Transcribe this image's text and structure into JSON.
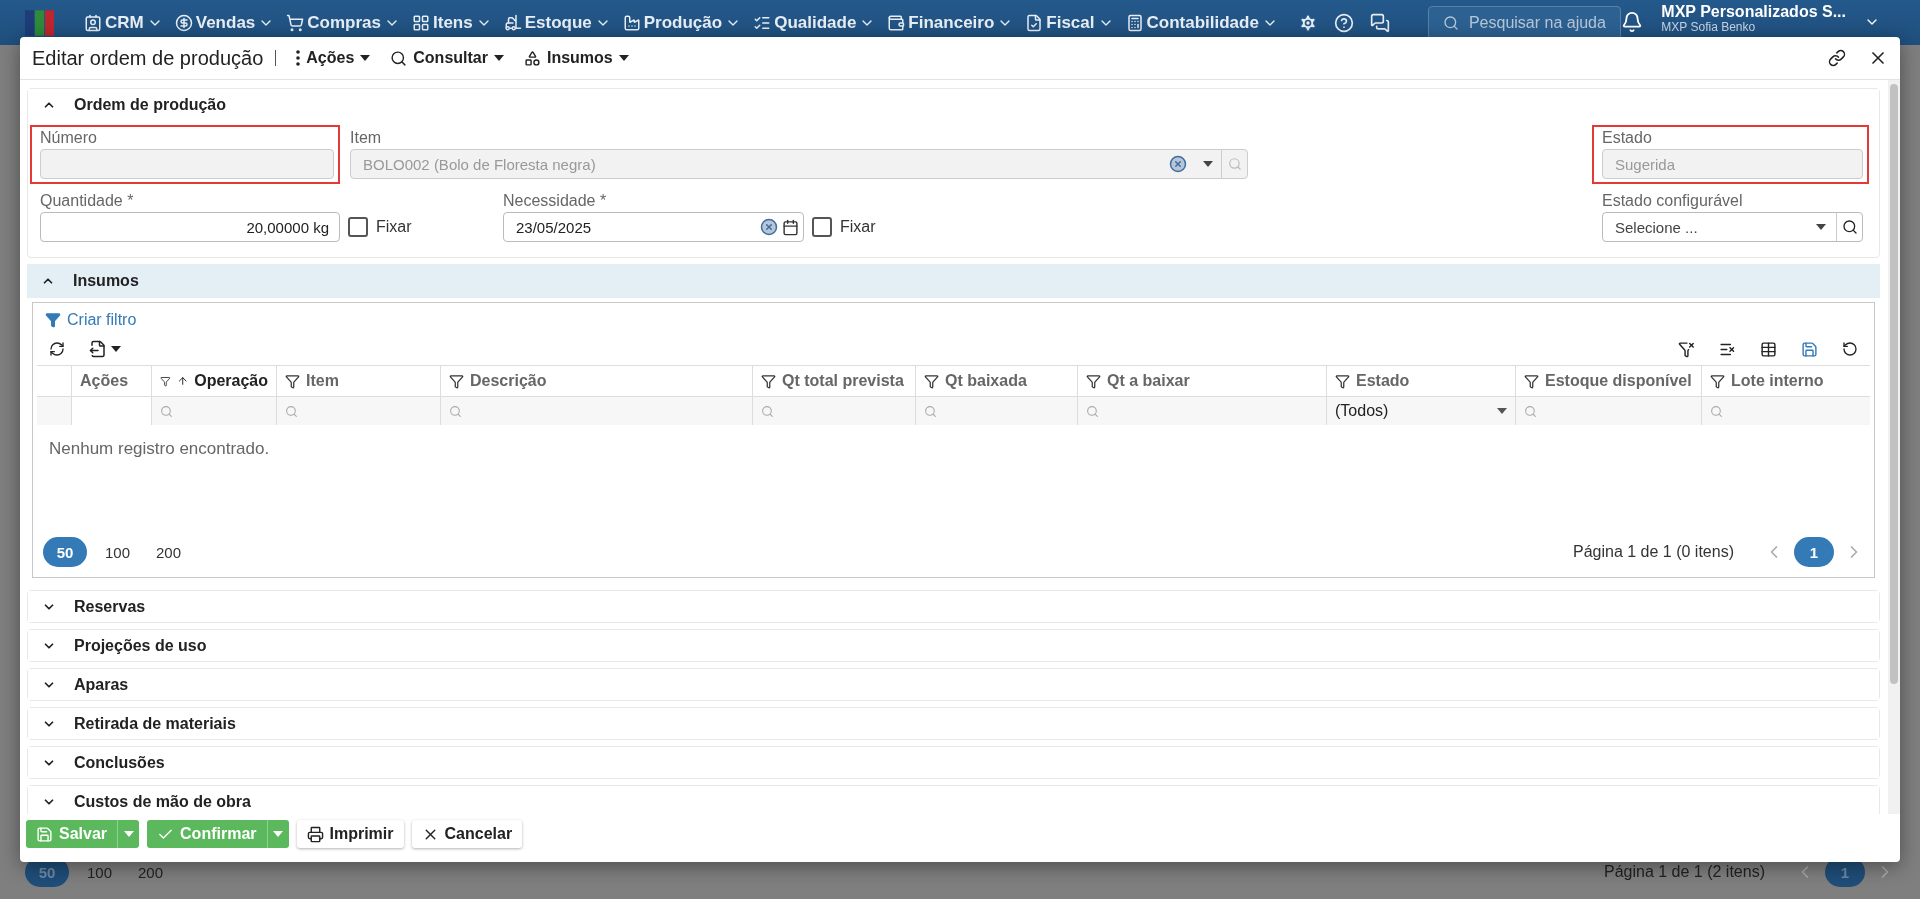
{
  "top_bar": {
    "menu": [
      {
        "label": "CRM"
      },
      {
        "label": "Vendas"
      },
      {
        "label": "Compras"
      },
      {
        "label": "Itens"
      },
      {
        "label": "Estoque"
      },
      {
        "label": "Produção"
      },
      {
        "label": "Qualidade"
      },
      {
        "label": "Financeiro"
      },
      {
        "label": "Fiscal"
      },
      {
        "label": "Contabilidade"
      }
    ],
    "search": {
      "placeholder": "Pesquisar na ajuda"
    },
    "company": "MXP Personalizados S...",
    "user": "MXP Sofia Benko"
  },
  "background_page": {
    "page_sizes": [
      {
        "label": "50",
        "selected": true
      },
      {
        "label": "100",
        "selected": false
      },
      {
        "label": "200",
        "selected": false
      }
    ],
    "page_info": "Página 1 de 1 (2 itens)",
    "pages": [
      {
        "label": "1",
        "selected": true
      }
    ]
  },
  "dialog": {
    "title": "Editar ordem de produção",
    "menus": [
      {
        "label": "Ações"
      },
      {
        "label": "Consultar"
      },
      {
        "label": "Insumos"
      }
    ],
    "order_section": {
      "title": "Ordem de produção",
      "expanded": true,
      "fields": [
        {
          "kind": "text",
          "label": "Número",
          "disabled": true,
          "highlighted": true
        },
        {
          "kind": "lookup",
          "label": "Item",
          "value": "BOLO002 (Bolo de Floresta negra)",
          "disabled": true,
          "highlighted": false
        },
        {
          "kind": "text",
          "label": "Estado",
          "value": "Sugerida",
          "disabled": true,
          "highlighted": true
        },
        {
          "kind": "number",
          "label": "Quantidade *",
          "value": "20,00000 kg",
          "disabled": false,
          "highlighted": false,
          "fix": {
            "label": "Fixar",
            "checked": false
          }
        },
        {
          "kind": "date",
          "label": "Necessidade *",
          "value": "23/05/2025",
          "disabled": false,
          "highlighted": false,
          "fix": {
            "label": "Fixar",
            "checked": false
          }
        },
        {
          "kind": "select",
          "label": "Estado configurável",
          "placeholder": "Selecione ...",
          "disabled": false,
          "highlighted": false
        }
      ]
    },
    "inputs_section": {
      "title": "Insumos",
      "expanded": true,
      "filter_link": "Criar filtro",
      "columns": [
        {
          "label": "Ações",
          "filterable": false,
          "sorted": false
        },
        {
          "label": "Operação",
          "filterable": true,
          "sorted": true
        },
        {
          "label": "Item",
          "filterable": true,
          "sorted": false
        },
        {
          "label": "Descrição",
          "filterable": true,
          "sorted": false
        },
        {
          "label": "Qt total prevista",
          "filterable": true,
          "sorted": false
        },
        {
          "label": "Qt baixada",
          "filterable": true,
          "sorted": false
        },
        {
          "label": "Qt a baixar",
          "filterable": true,
          "sorted": false
        },
        {
          "label": "Estado",
          "filterable": true,
          "sorted": false
        },
        {
          "label": "Estoque disponível",
          "filterable": true,
          "sorted": false
        },
        {
          "label": "Lote interno",
          "filterable": true,
          "sorted": false
        }
      ],
      "filter_row": [
        {
          "kind": "empty"
        },
        {
          "kind": "search"
        },
        {
          "kind": "search"
        },
        {
          "kind": "search"
        },
        {
          "kind": "search"
        },
        {
          "kind": "search"
        },
        {
          "kind": "search"
        },
        {
          "kind": "select",
          "value": "(Todos)"
        },
        {
          "kind": "search"
        },
        {
          "kind": "search"
        }
      ],
      "empty_message": "Nenhum registro encontrado.",
      "page_sizes": [
        {
          "label": "50",
          "selected": true
        },
        {
          "label": "100",
          "selected": false
        },
        {
          "label": "200",
          "selected": false
        }
      ],
      "page_info": "Página 1 de 1 (0 itens)",
      "pages": [
        {
          "label": "1",
          "selected": true
        }
      ]
    },
    "sections": [
      {
        "title": "Reservas",
        "expanded": false
      },
      {
        "title": "Projeções de uso",
        "expanded": false
      },
      {
        "title": "Aparas",
        "expanded": false
      },
      {
        "title": "Retirada de materiais",
        "expanded": false
      },
      {
        "title": "Conclusões",
        "expanded": false
      },
      {
        "title": "Custos de mão de obra",
        "expanded": false
      }
    ],
    "buttons": [
      {
        "label": "Salvar",
        "kind": "primary",
        "split": true
      },
      {
        "label": "Confirmar",
        "kind": "primary",
        "split": true
      },
      {
        "label": "Imprimir",
        "kind": "default",
        "split": false
      },
      {
        "label": "Cancelar",
        "kind": "default",
        "split": false
      }
    ]
  }
}
